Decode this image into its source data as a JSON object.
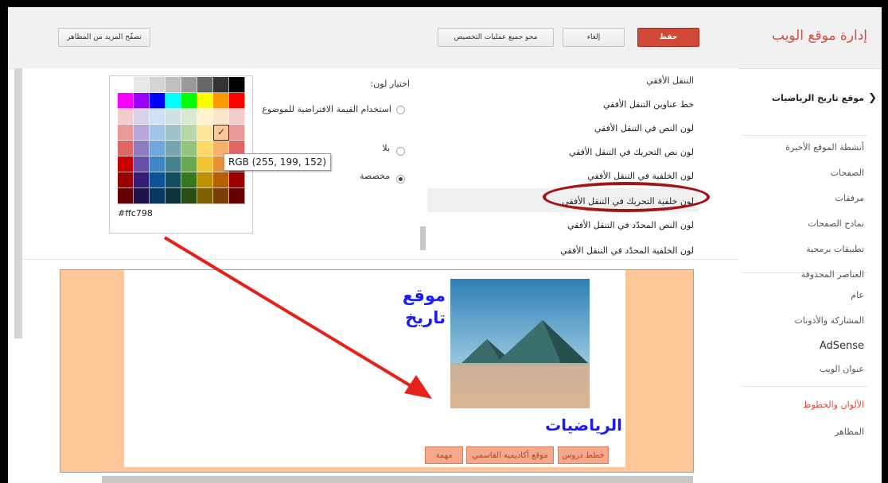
{
  "header": {
    "title": "إدارة موقع الويب",
    "save_label": "حفظ",
    "cancel_label": "إلغاء",
    "clear_all_label": "محو جميع عمليات التخصيص",
    "browse_themes_label": "تصفّح المزيد من المظاهر"
  },
  "sidebar": {
    "site_name": "موقع تاريخ الرياضيات",
    "back_icon": "chevron-left-icon",
    "group1": [
      "أنشطة الموقع الأخيرة",
      "الصفحات",
      "مرفقات",
      "نماذج الصفحات",
      "تطبيقات برمجية",
      "العناصر المحذوفة"
    ],
    "group2": [
      "عام",
      "المشاركة والأذونات",
      "AdSense",
      "عنوان الويب"
    ],
    "group3": [
      "الألوان والخطوط",
      "المظاهر"
    ],
    "active_item": "الألوان والخطوط",
    "active_color": "#dd4b39"
  },
  "options": {
    "items": [
      "التنقل الأفقي",
      "خط عناوين التنقل الأفقي",
      "لون النص في التنقل الأفقي",
      "لون نص التحريك في التنقل الأفقي",
      "لون الخلفية في التنقل الأفقي",
      "لون خلفية التحريك في التنقل الأفقي",
      "لون النص المحدّد في التنقل الأفقي",
      "لون الخلفية المحدّد في التنقل الأفقي"
    ],
    "selected_index": 4
  },
  "color_choice": {
    "heading": "اختيار لون:",
    "use_default": "استخدام القيمة الافتراضية للموضوع",
    "none": "بلا",
    "custom": "مخصصة",
    "selected": "custom"
  },
  "picker": {
    "tooltip": "RGB (255, 199, 152)",
    "hex_value": "#ffc798",
    "check_icon": "checkmark-icon",
    "colors": [
      [
        "#ffffff",
        "#e8e8e8",
        "#d4d4d4",
        "#bfbfbf",
        "#999999",
        "#666666",
        "#333333",
        "#000000"
      ],
      [
        "#ff00ff",
        "#9900ff",
        "#0000ff",
        "#00ffff",
        "#00ff00",
        "#ffff00",
        "#ff9900",
        "#ff0000"
      ],
      [
        "#f4cccc",
        "#d9d2e9",
        "#cfe2f3",
        "#d0e0e3",
        "#d9ead3",
        "#fff2cc",
        "#fce5cd",
        "#f4cccc"
      ],
      [
        "#ea9999",
        "#b4a7d6",
        "#9fc5e8",
        "#a2c4c9",
        "#b6d7a8",
        "#ffe599",
        "#ffc798",
        "#ea9999"
      ],
      [
        "#e06666",
        "#8e7cc3",
        "#6fa8dc",
        "#76a5af",
        "#93c47d",
        "#ffd966",
        "#f6b26b",
        "#e06666"
      ],
      [
        "#cc0000",
        "#674ea7",
        "#3d85c6",
        "#45818e",
        "#6aa84f",
        "#f1c232",
        "#e69138",
        "#cc0000"
      ],
      [
        "#990000",
        "#351c75",
        "#0b5394",
        "#134f5c",
        "#38761d",
        "#bf9000",
        "#b45f06",
        "#990000"
      ],
      [
        "#660000",
        "#20124d",
        "#073763",
        "#0c343d",
        "#274e13",
        "#7f6000",
        "#783f04",
        "#660000"
      ]
    ]
  },
  "preview": {
    "site_title_line1": "موقع",
    "site_title_line2": "تاريخ",
    "site_subtitle": "الرياضيات",
    "nav_tabs": [
      "خطط دروس",
      "موقع أكاديمية القاسمي",
      "مهمة"
    ],
    "background_color": "#ffc798",
    "title_color": "#1a1aff"
  },
  "annotation": {
    "circle_color": "#a31515",
    "arrow_color": "#e8201a"
  }
}
